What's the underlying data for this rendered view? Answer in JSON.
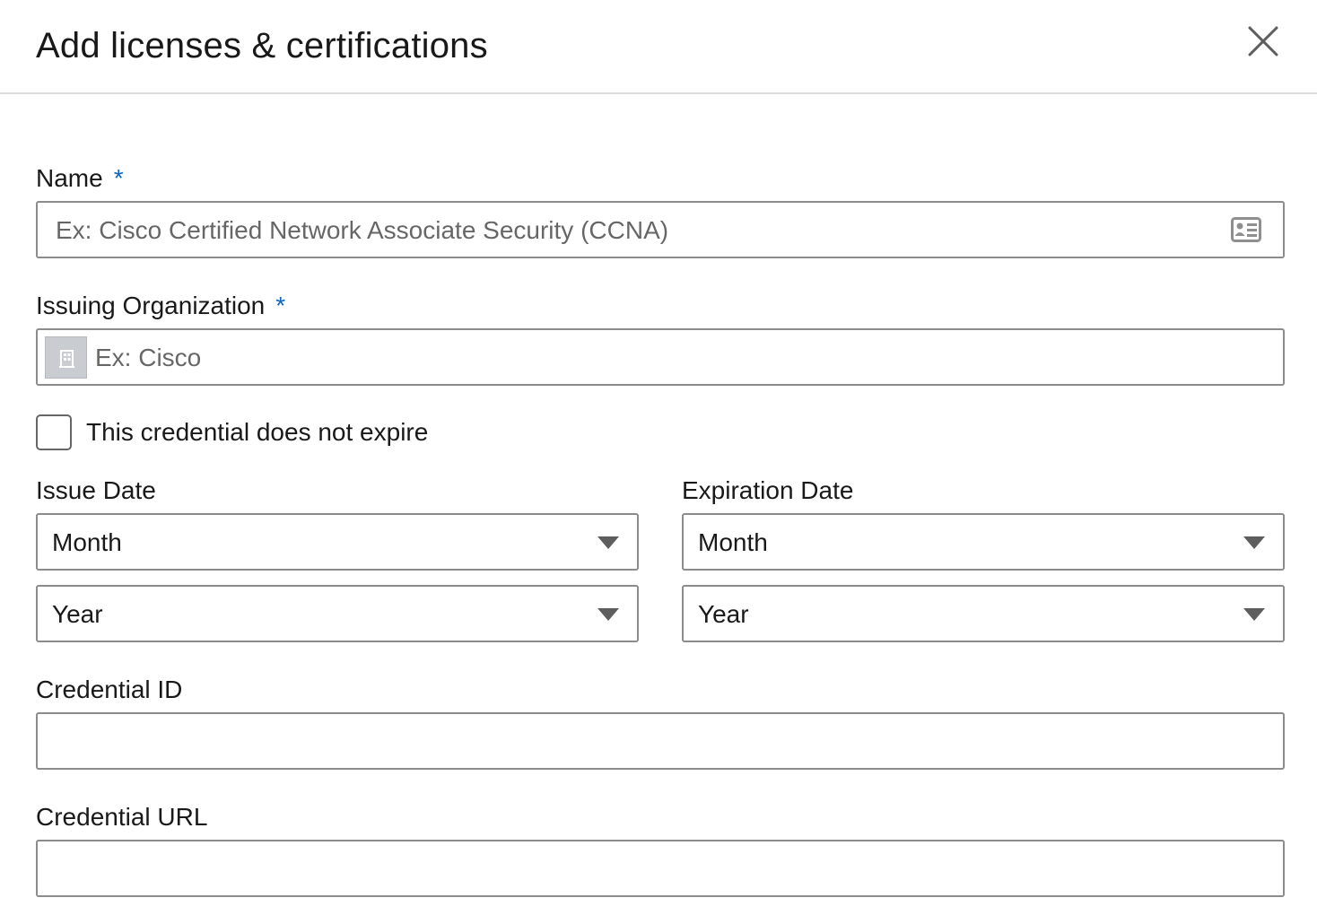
{
  "dialog": {
    "title": "Add licenses & certifications",
    "close_icon": "close-icon"
  },
  "name": {
    "label": "Name",
    "required_marker": "*",
    "placeholder": "Ex: Cisco Certified Network Associate Security (CCNA)",
    "value": "",
    "icon": "contact-card-icon"
  },
  "issuing_organization": {
    "label": "Issuing Organization",
    "required_marker": "*",
    "placeholder": "Ex: Cisco",
    "value": "",
    "icon": "company-logo-placeholder-icon"
  },
  "no_expire_checkbox": {
    "label": "This credential does not expire",
    "checked": false
  },
  "issue_date": {
    "label": "Issue Date",
    "month": "Month",
    "year": "Year"
  },
  "expiration_date": {
    "label": "Expiration Date",
    "month": "Month",
    "year": "Year"
  },
  "credential_id": {
    "label": "Credential ID",
    "value": ""
  },
  "credential_url": {
    "label": "Credential URL",
    "value": ""
  },
  "colors": {
    "required_accent": "#0a66c2",
    "border": "#8c8c8c",
    "divider": "#dcdcdc"
  }
}
